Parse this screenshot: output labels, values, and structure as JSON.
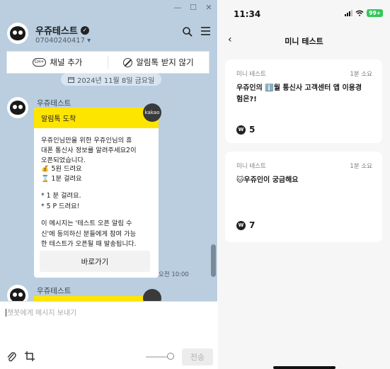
{
  "chat": {
    "window_controls": [
      "—",
      "☐",
      "✕"
    ],
    "channel_name": "우쥬테스트",
    "channel_phone": "07040240417 ▾",
    "action_add_channel": "채널 추가",
    "action_block_alimtalk": "알림톡 받지 않기",
    "date_label": "2024년 11월 8일 금요일",
    "sender": "우쥬테스트",
    "bubble_header": "알림톡 도착",
    "kakao_badge": "kakao",
    "message_lines": [
      "우쥬인님만을 위한 우쥬인님의 휴",
      "대폰 통신사 정보를 알려주세요2이",
      "오픈되었습니다.",
      "💰 5원 드려요",
      "⌛ 1분 걸려요",
      "",
      "* 1 분 걸려요.",
      "* 5 P 드려요!",
      "",
      "이 메시지는 '테스트 오픈 알림 수",
      "신'에 동의하신 분들에게 참여 가능",
      "한 테스트가 오픈될 때 발송됩니다."
    ],
    "bubble_button": "바로가기",
    "message_time": "오전 10:00",
    "sender2": "우쥬테스트",
    "composer_placeholder": "챗봇에게 메시지 보내기",
    "send_label": "전송"
  },
  "phone": {
    "time": "11:34",
    "battery": "99+",
    "title": "미니 테스트",
    "back_symbol": "‹",
    "cards": [
      {
        "tag": "미니 테스트",
        "time": "1분 소요",
        "title": "우쥬인의 ℹ️월 통신사 고객센터 앱 이용경험은?!",
        "reward": "5"
      },
      {
        "tag": "미니 테스트",
        "time": "1분 소요",
        "title": "🐱우쥬인이 궁금해요",
        "reward": "7"
      }
    ]
  },
  "colors": {
    "chat_bg": "#bacee0",
    "kakao_yellow": "#fee500",
    "phone_bg": "#f6f6f6",
    "battery_green": "#34c759"
  },
  "icons": [
    "search-icon",
    "menu-icon",
    "channel-add-icon",
    "block-icon",
    "calendar-icon",
    "paperclip-icon",
    "crop-icon",
    "wifi-icon",
    "signal-icon",
    "w-coin-icon"
  ]
}
